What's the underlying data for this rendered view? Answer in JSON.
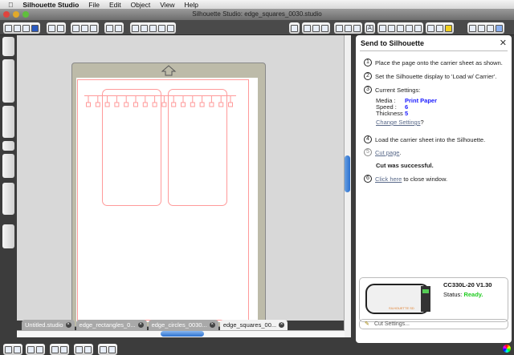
{
  "menubar": {
    "apple": "",
    "app": "Silhouette Studio",
    "items": [
      "File",
      "Edit",
      "Object",
      "View",
      "Help"
    ]
  },
  "window": {
    "title": "Silhouette Studio: edge_squares_0030.studio"
  },
  "tabs": [
    {
      "label": "Untitled.studio",
      "active": false
    },
    {
      "label": "edge_rectangles_0...",
      "active": false
    },
    {
      "label": "edge_circles_0030...",
      "active": false
    },
    {
      "label": "edge_squares_00...",
      "active": true
    }
  ],
  "panel": {
    "title": "Send to Silhouette",
    "close": "✕",
    "steps": [
      {
        "n": "1",
        "text": "Place the page onto the carrier sheet as shown."
      },
      {
        "n": "2",
        "text": "Set the Silhouette display to 'Load w/ Carrier'."
      },
      {
        "n": "3",
        "text": "Current Settings:"
      },
      {
        "n": "4",
        "text": "Load the carrier sheet into the Silhouette."
      },
      {
        "n": "5",
        "link": "Cut page",
        "after": "."
      },
      {
        "n": "6",
        "link": "Click here",
        "after": " to close window."
      }
    ],
    "settings": {
      "media_label": "Media :",
      "media": "Print Paper",
      "speed_label": "Speed :",
      "speed": "6",
      "thickness_label": "Thickness",
      "thickness": "5"
    },
    "change_settings": "Change Settings",
    "change_suffix": "?",
    "result": "Cut was successful.",
    "device": {
      "model": "CC330L-20 V1.30",
      "status_label": "Status:",
      "status": "Ready.",
      "status_color": "#22cc22",
      "brand": "SILHOUETTE SD"
    },
    "cut_settings": "Cut Settings..."
  },
  "colors": {
    "cut_line": "#ff9a9a",
    "mat": "#bdbba9",
    "link_value": "#1a1aff"
  }
}
